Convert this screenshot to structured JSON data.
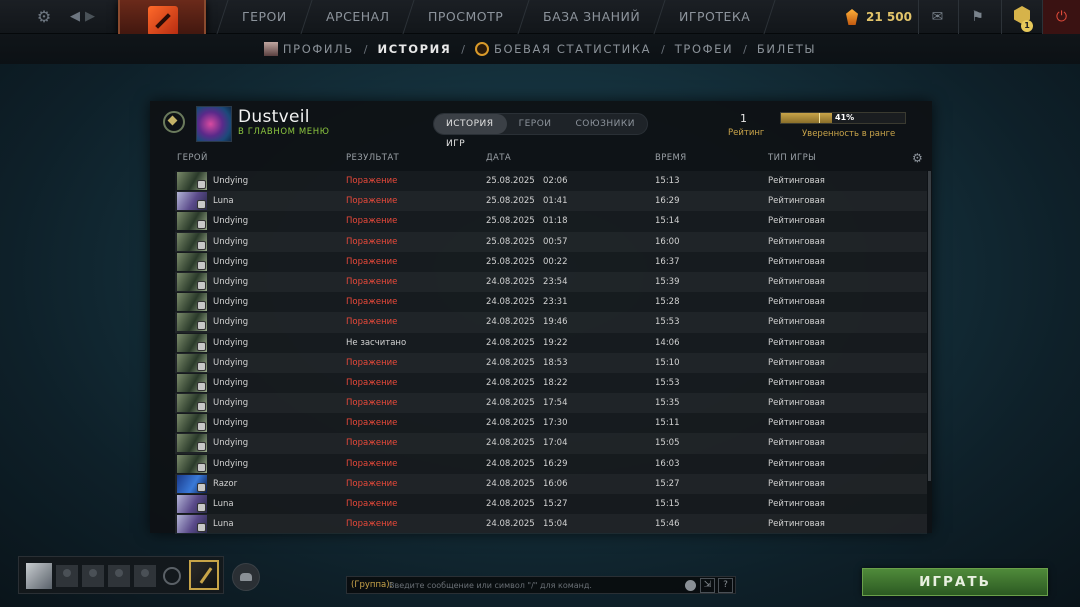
{
  "topbar": {
    "nav": [
      "ГЕРОИ",
      "АРСЕНАЛ",
      "ПРОСМОТР",
      "БАЗА ЗНАНИЙ",
      "ИГРОТЕКА"
    ],
    "currency": "21 500",
    "notification_count": "1"
  },
  "subnav": {
    "profile": "ПРОФИЛЬ",
    "history": "ИСТОРИЯ",
    "stats": "БОЕВАЯ СТАТИСТИКА",
    "trophies": "ТРОФЕИ",
    "tickets": "БИЛЕТЫ",
    "separator": "/"
  },
  "player": {
    "name": "Dustveil",
    "status": "В ГЛАВНОМ МЕНЮ",
    "rating": "1",
    "rating_label": "Рейтинг",
    "confidence": "41%",
    "confidence_fraction": 0.41,
    "confidence_label": "Уверенность в ранге"
  },
  "tabs": [
    "ИСТОРИЯ ИГР",
    "ГЕРОИ",
    "СОЮЗНИКИ"
  ],
  "columns": {
    "hero": "ГЕРОЙ",
    "result": "РЕЗУЛЬТАТ",
    "date": "ДАТА",
    "duration": "ВРЕМЯ",
    "mode": "ТИП ИГРЫ"
  },
  "colors": {
    "loss": "#e8493a",
    "accent_gold": "#c9a44a",
    "online_green": "#8cc63f",
    "play_green": "#4f8a3a"
  },
  "matches": [
    {
      "hero": "Undying",
      "hero_key": "undying",
      "result": "Поражение",
      "loss": true,
      "date": "25.08.2025",
      "time": "02:06",
      "duration": "15:13",
      "mode": "Рейтинговая"
    },
    {
      "hero": "Luna",
      "hero_key": "luna",
      "result": "Поражение",
      "loss": true,
      "date": "25.08.2025",
      "time": "01:41",
      "duration": "16:29",
      "mode": "Рейтинговая"
    },
    {
      "hero": "Undying",
      "hero_key": "undying",
      "result": "Поражение",
      "loss": true,
      "date": "25.08.2025",
      "time": "01:18",
      "duration": "15:14",
      "mode": "Рейтинговая"
    },
    {
      "hero": "Undying",
      "hero_key": "undying",
      "result": "Поражение",
      "loss": true,
      "date": "25.08.2025",
      "time": "00:57",
      "duration": "16:00",
      "mode": "Рейтинговая"
    },
    {
      "hero": "Undying",
      "hero_key": "undying",
      "result": "Поражение",
      "loss": true,
      "date": "25.08.2025",
      "time": "00:22",
      "duration": "16:37",
      "mode": "Рейтинговая"
    },
    {
      "hero": "Undying",
      "hero_key": "undying",
      "result": "Поражение",
      "loss": true,
      "date": "24.08.2025",
      "time": "23:54",
      "duration": "15:39",
      "mode": "Рейтинговая"
    },
    {
      "hero": "Undying",
      "hero_key": "undying",
      "result": "Поражение",
      "loss": true,
      "date": "24.08.2025",
      "time": "23:31",
      "duration": "15:28",
      "mode": "Рейтинговая"
    },
    {
      "hero": "Undying",
      "hero_key": "undying",
      "result": "Поражение",
      "loss": true,
      "date": "24.08.2025",
      "time": "19:46",
      "duration": "15:53",
      "mode": "Рейтинговая"
    },
    {
      "hero": "Undying",
      "hero_key": "undying",
      "result": "Не засчитано",
      "loss": false,
      "date": "24.08.2025",
      "time": "19:22",
      "duration": "14:06",
      "mode": "Рейтинговая"
    },
    {
      "hero": "Undying",
      "hero_key": "undying",
      "result": "Поражение",
      "loss": true,
      "date": "24.08.2025",
      "time": "18:53",
      "duration": "15:10",
      "mode": "Рейтинговая"
    },
    {
      "hero": "Undying",
      "hero_key": "undying",
      "result": "Поражение",
      "loss": true,
      "date": "24.08.2025",
      "time": "18:22",
      "duration": "15:53",
      "mode": "Рейтинговая"
    },
    {
      "hero": "Undying",
      "hero_key": "undying",
      "result": "Поражение",
      "loss": true,
      "date": "24.08.2025",
      "time": "17:54",
      "duration": "15:35",
      "mode": "Рейтинговая"
    },
    {
      "hero": "Undying",
      "hero_key": "undying",
      "result": "Поражение",
      "loss": true,
      "date": "24.08.2025",
      "time": "17:30",
      "duration": "15:11",
      "mode": "Рейтинговая"
    },
    {
      "hero": "Undying",
      "hero_key": "undying",
      "result": "Поражение",
      "loss": true,
      "date": "24.08.2025",
      "time": "17:04",
      "duration": "15:05",
      "mode": "Рейтинговая"
    },
    {
      "hero": "Undying",
      "hero_key": "undying",
      "result": "Поражение",
      "loss": true,
      "date": "24.08.2025",
      "time": "16:29",
      "duration": "16:03",
      "mode": "Рейтинговая"
    },
    {
      "hero": "Razor",
      "hero_key": "razor",
      "result": "Поражение",
      "loss": true,
      "date": "24.08.2025",
      "time": "16:06",
      "duration": "15:27",
      "mode": "Рейтинговая"
    },
    {
      "hero": "Luna",
      "hero_key": "luna",
      "result": "Поражение",
      "loss": true,
      "date": "24.08.2025",
      "time": "15:27",
      "duration": "15:15",
      "mode": "Рейтинговая"
    },
    {
      "hero": "Luna",
      "hero_key": "luna",
      "result": "Поражение",
      "loss": true,
      "date": "24.08.2025",
      "time": "15:04",
      "duration": "15:46",
      "mode": "Рейтинговая"
    }
  ],
  "chat": {
    "prefix": "(Группа):",
    "placeholder": "Введите сообщение или символ \"/\" для команд."
  },
  "play_label": "ИГРАТЬ",
  "icons": {
    "settings": "gear-icon",
    "back": "chevron-left-icon",
    "forward": "chevron-right-icon",
    "mail": "mail-icon",
    "store": "store-icon",
    "power": "power-icon"
  }
}
